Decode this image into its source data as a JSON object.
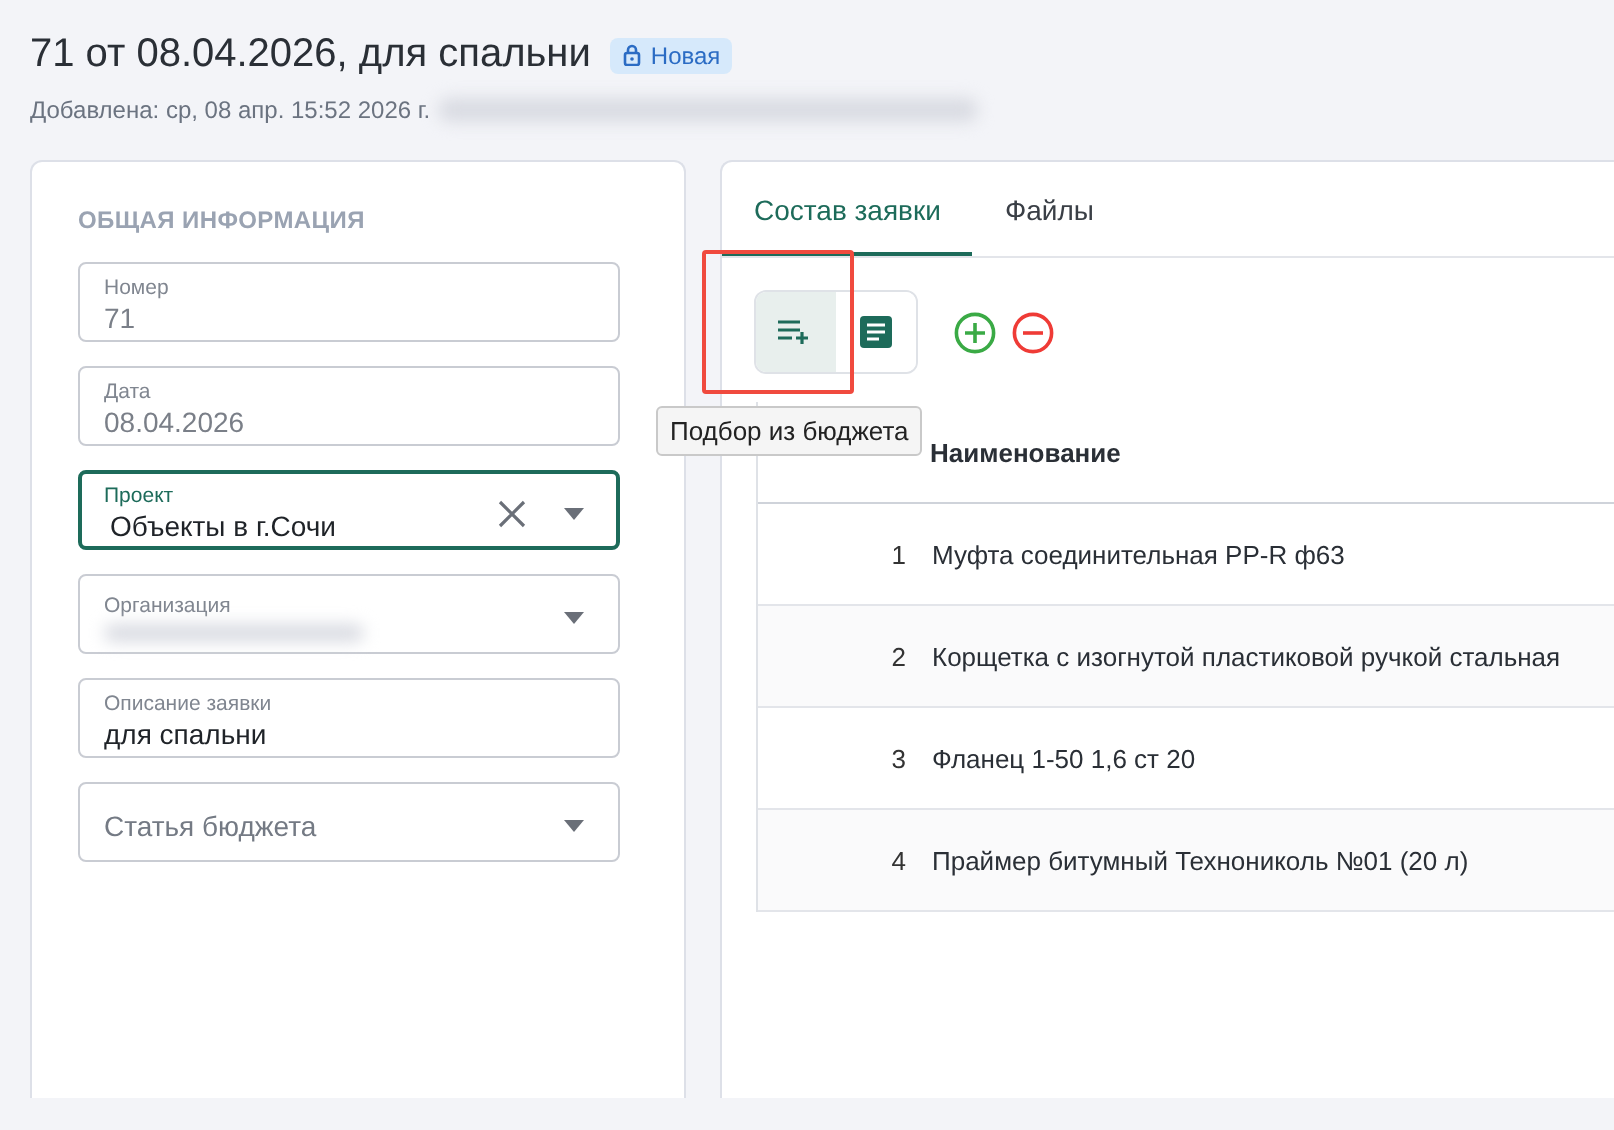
{
  "header": {
    "title": "71 от 08.04.2026, для спальни",
    "status_badge": "Новая",
    "added": "Добавлена: ср, 08 апр. 15:52 2026 г."
  },
  "info_panel": {
    "heading": "ОБЩАЯ ИНФОРМАЦИЯ",
    "fields": [
      {
        "kind": "text",
        "label": "Номер",
        "value": "71",
        "disabled": true,
        "focused": false
      },
      {
        "kind": "text",
        "label": "Дата",
        "value": "08.04.2026",
        "disabled": true,
        "focused": false
      },
      {
        "kind": "select",
        "label": "Проект",
        "value": "Объекты в г.Сочи",
        "clearable": true,
        "focused": true
      },
      {
        "kind": "select",
        "label": "Организация",
        "redacted": true,
        "clearable": false,
        "focused": false
      },
      {
        "kind": "text",
        "label": "Описание заявки",
        "value": "для спальни",
        "disabled": false,
        "focused": false
      },
      {
        "kind": "select",
        "placeholder": "Статья бюджета",
        "clearable": false,
        "focused": false
      }
    ]
  },
  "tabs": [
    {
      "label": "Состав заявки",
      "selected": true
    },
    {
      "label": "Файлы",
      "selected": false
    }
  ],
  "toolbar": {
    "tooltip": "Подбор из бюджета"
  },
  "table": {
    "columns": [
      "Наименование"
    ],
    "rows": [
      {
        "number": "1",
        "name": "Муфта соединительная PP-R ф63"
      },
      {
        "number": "2",
        "name": "Корщетка с изогнутой пластиковой ручкой стальная"
      },
      {
        "number": "3",
        "name": "Фланец 1-50 1,6 ст 20"
      },
      {
        "number": "4",
        "name": "Праймер битумный Технониколь №01 (20 л)"
      }
    ]
  }
}
